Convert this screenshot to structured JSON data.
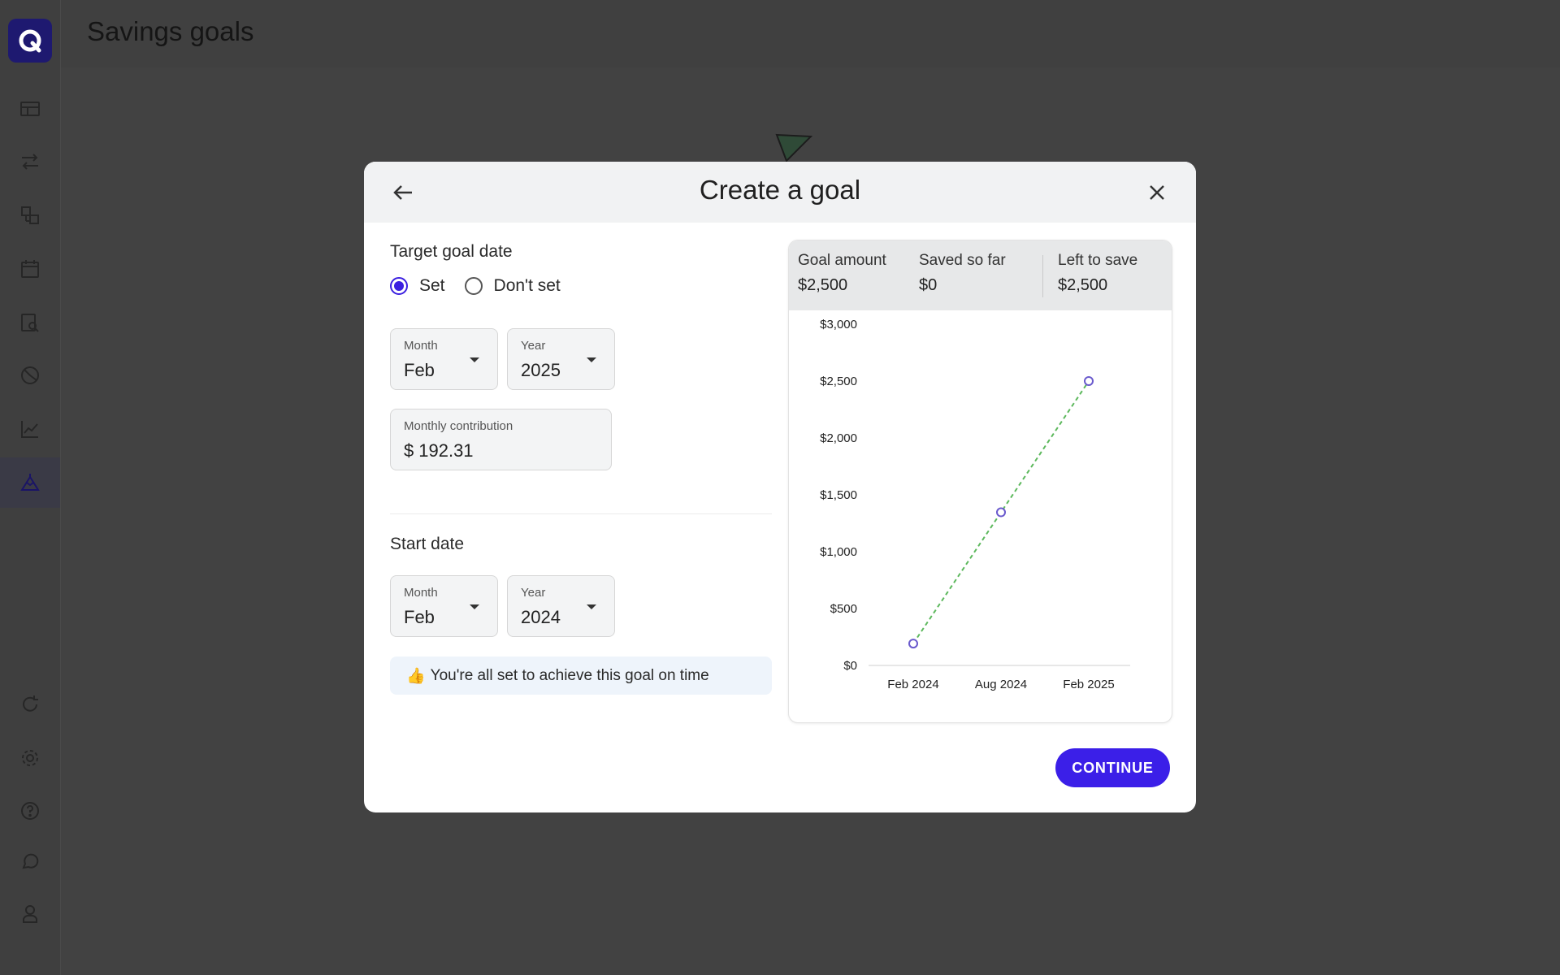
{
  "page": {
    "title": "Savings goals"
  },
  "sidebar": {
    "items": [
      {
        "icon": "dashboard-icon"
      },
      {
        "icon": "transactions-icon"
      },
      {
        "icon": "categories-icon"
      },
      {
        "icon": "calendar-icon"
      },
      {
        "icon": "reports-search-icon"
      },
      {
        "icon": "budget-pie-icon"
      },
      {
        "icon": "investments-chart-icon"
      },
      {
        "icon": "goals-mountain-icon",
        "active": true
      },
      {
        "icon": "refresh-icon"
      },
      {
        "icon": "settings-gear-icon"
      },
      {
        "icon": "help-icon"
      },
      {
        "icon": "chat-icon"
      },
      {
        "icon": "profile-icon"
      }
    ]
  },
  "modal": {
    "title": "Create a goal",
    "target": {
      "label": "Target goal date",
      "options": [
        "Set",
        "Don't set"
      ],
      "selected": "Set",
      "month_label": "Month",
      "month_value": "Feb",
      "year_label": "Year",
      "year_value": "2025"
    },
    "contribution": {
      "label": "Monthly contribution",
      "prefix": "$",
      "value": "192.31"
    },
    "start": {
      "label": "Start date",
      "month_label": "Month",
      "month_value": "Feb",
      "year_label": "Year",
      "year_value": "2024"
    },
    "notice": {
      "emoji": "👍",
      "text": "You're all set to achieve this goal on time"
    },
    "summary": {
      "goal_amount_label": "Goal amount",
      "goal_amount": "$2,500",
      "saved_label": "Saved so far",
      "saved": "$0",
      "left_label": "Left to save",
      "left": "$2,500"
    },
    "continue_label": "CONTINUE"
  },
  "colors": {
    "accent": "#3b1fe8",
    "line": "#5cb85c",
    "point": "#6a5acd"
  },
  "chart_data": {
    "type": "line",
    "x": [
      "Feb 2024",
      "Aug 2024",
      "Feb 2025"
    ],
    "values": [
      192.31,
      1346.17,
      2500
    ],
    "ylim": [
      0,
      3000
    ],
    "yticks": [
      "$0",
      "$500",
      "$1,000",
      "$1,500",
      "$2,000",
      "$2,500",
      "$3,000"
    ],
    "ytick_values": [
      0,
      500,
      1000,
      1500,
      2000,
      2500,
      3000
    ],
    "grid": false,
    "line_style": "dashed"
  }
}
